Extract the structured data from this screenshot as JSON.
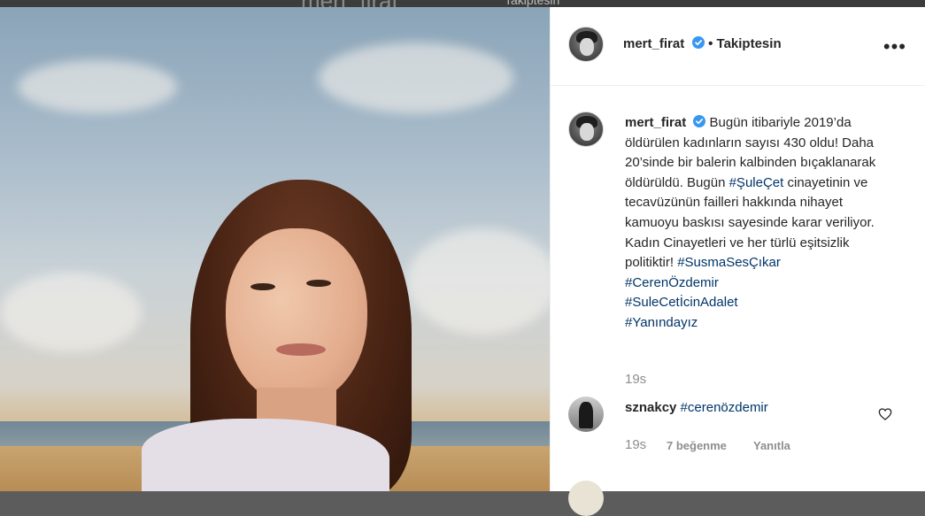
{
  "background": {
    "ghost_username": "mert_firat",
    "ghost_follow": "Takiptesin"
  },
  "post": {
    "author": "mert_firat",
    "follow_status": "• Takiptesin",
    "more_icon": "more-dots-icon",
    "verified_icon": "verified-badge-icon",
    "caption": {
      "text_1": "Bugün itibariyle 2019’da öldürülen kadınların sayısı 430 oldu! Daha 20’sinde bir balerin kalbinden bıçaklanarak öldürüldü. Bugün ",
      "tag_1": "#ŞuleÇet",
      "text_2": " cinayetinin ve tecavüzünün failleri hakkında nihayet kamuoyu baskısı sayesinde karar veriliyor. Kadın Cinayetleri ve her türlü eşitsizlik politiktir! ",
      "tag_2": "#SusmaSesÇıkar",
      "tag_3": "#CerenÖzdemir",
      "tag_4": "#SuleCetİcinAdalet",
      "tag_5": "#Yanındayız"
    },
    "caption_time": "19s"
  },
  "comments": [
    {
      "user": "sznakcy",
      "text": "#cerenözdemir",
      "time": "19s",
      "likes": "7 beğenme",
      "reply": "Yanıtla",
      "heart_icon": "heart-outline-icon"
    }
  ],
  "colors": {
    "link": "#003569",
    "verified": "#3897f0",
    "muted": "#8e8e8e",
    "text": "#262626"
  }
}
